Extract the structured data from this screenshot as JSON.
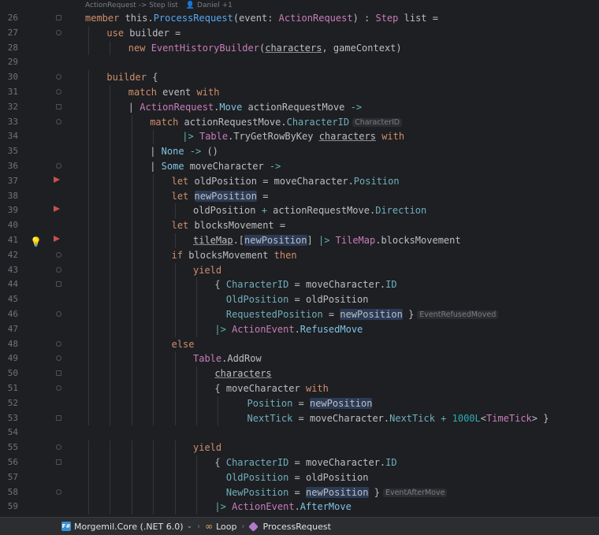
{
  "hint": {
    "signature": "ActionRequest -> Step list",
    "author": "Daniel +1"
  },
  "lines": [
    {
      "n": "26",
      "indent": 0,
      "tokens": [
        [
          "kw",
          "member "
        ],
        [
          "plain",
          "this."
        ],
        [
          "fn",
          "ProcessRequest"
        ],
        [
          "plain",
          "(event: "
        ],
        [
          "ty",
          "ActionRequest"
        ],
        [
          "plain",
          ") : "
        ],
        [
          "ty",
          "Step"
        ],
        [
          "plain",
          " list ="
        ]
      ]
    },
    {
      "n": "27",
      "indent": 1,
      "tokens": [
        [
          "kw",
          "use "
        ],
        [
          "plain",
          "builder ="
        ]
      ]
    },
    {
      "n": "28",
      "indent": 2,
      "tokens": [
        [
          "kw",
          "new "
        ],
        [
          "ty",
          "EventHistoryBuilder"
        ],
        [
          "plain",
          "("
        ],
        [
          "und",
          "characters"
        ],
        [
          "plain",
          ", gameContext)"
        ]
      ]
    },
    {
      "n": "29",
      "indent": 0,
      "tokens": []
    },
    {
      "n": "30",
      "indent": 1,
      "tokens": [
        [
          "kw",
          "builder "
        ],
        [
          "plain",
          "{"
        ]
      ]
    },
    {
      "n": "31",
      "indent": 2,
      "tokens": [
        [
          "kw",
          "match "
        ],
        [
          "plain",
          "event "
        ],
        [
          "kw",
          "with"
        ]
      ]
    },
    {
      "n": "32",
      "indent": 2,
      "tokens": [
        [
          "plain",
          "| "
        ],
        [
          "ty",
          "ActionRequest"
        ],
        [
          "plain",
          "."
        ],
        [
          "kw2",
          "Move"
        ],
        [
          "plain",
          " actionRequestMove "
        ],
        [
          "op",
          "->"
        ]
      ]
    },
    {
      "n": "33",
      "indent": 3,
      "tokens": [
        [
          "kw",
          "match "
        ],
        [
          "plain",
          "actionRequestMove."
        ],
        [
          "fld",
          "CharacterID"
        ],
        [
          "inlay",
          "CharacterID"
        ]
      ]
    },
    {
      "n": "34",
      "indent": 4.5,
      "tokens": [
        [
          "op",
          "|> "
        ],
        [
          "ty",
          "Table"
        ],
        [
          "plain",
          ".TryGetRowByKey "
        ],
        [
          "und",
          "characters"
        ],
        [
          "plain",
          " "
        ],
        [
          "kw",
          "with"
        ]
      ]
    },
    {
      "n": "35",
      "indent": 3,
      "tokens": [
        [
          "plain",
          "| "
        ],
        [
          "kw2",
          "None"
        ],
        [
          "plain",
          " "
        ],
        [
          "op",
          "->"
        ],
        [
          "plain",
          " ()"
        ]
      ]
    },
    {
      "n": "36",
      "indent": 3,
      "tokens": [
        [
          "plain",
          "| "
        ],
        [
          "kw2",
          "Some"
        ],
        [
          "plain",
          " moveCharacter "
        ],
        [
          "op",
          "->"
        ]
      ]
    },
    {
      "n": "37",
      "indent": 4,
      "tokens": [
        [
          "kw",
          "let "
        ],
        [
          "plain",
          "oldPosition = moveCharacter."
        ],
        [
          "fld",
          "Position"
        ]
      ]
    },
    {
      "n": "38",
      "indent": 4,
      "tokens": [
        [
          "kw",
          "let "
        ],
        [
          "hl",
          "newPosition"
        ],
        [
          "plain",
          " ="
        ]
      ]
    },
    {
      "n": "39",
      "indent": 5,
      "tokens": [
        [
          "plain",
          "oldPosition "
        ],
        [
          "op",
          "+"
        ],
        [
          "plain",
          " actionRequestMove."
        ],
        [
          "fld",
          "Direction"
        ]
      ]
    },
    {
      "n": "40",
      "indent": 4,
      "tokens": [
        [
          "kw",
          "let "
        ],
        [
          "plain",
          "blocksMovement ="
        ]
      ]
    },
    {
      "n": "41",
      "indent": 5,
      "tokens": [
        [
          "und",
          "tileMap"
        ],
        [
          "plain",
          ".["
        ],
        [
          "hl",
          "newPosition"
        ],
        [
          "plain",
          "] "
        ],
        [
          "op",
          "|> "
        ],
        [
          "ty",
          "TileMap"
        ],
        [
          "plain",
          ".blocksMovement"
        ]
      ]
    },
    {
      "n": "42",
      "indent": 4,
      "tokens": [
        [
          "kw",
          "if "
        ],
        [
          "plain",
          "blocksMovement "
        ],
        [
          "kw",
          "then"
        ]
      ]
    },
    {
      "n": "43",
      "indent": 5,
      "tokens": [
        [
          "kw",
          "yield"
        ]
      ]
    },
    {
      "n": "44",
      "indent": 6,
      "tokens": [
        [
          "plain",
          "{ "
        ],
        [
          "fld",
          "CharacterID"
        ],
        [
          "plain",
          " = moveCharacter."
        ],
        [
          "fld",
          "ID"
        ]
      ]
    },
    {
      "n": "45",
      "indent": 6,
      "tokens": [
        [
          "plain",
          "  "
        ],
        [
          "fld",
          "OldPosition"
        ],
        [
          "plain",
          " = oldPosition"
        ]
      ]
    },
    {
      "n": "46",
      "indent": 6,
      "tokens": [
        [
          "plain",
          "  "
        ],
        [
          "fld",
          "RequestedPosition"
        ],
        [
          "plain",
          " = "
        ],
        [
          "hl",
          "newPosition"
        ],
        [
          "plain",
          " }"
        ],
        [
          "inlay",
          "EventRefusedMoved"
        ]
      ]
    },
    {
      "n": "47",
      "indent": 6,
      "tokens": [
        [
          "op",
          "|> "
        ],
        [
          "ty",
          "ActionEvent"
        ],
        [
          "plain",
          "."
        ],
        [
          "kw2",
          "RefusedMove"
        ]
      ]
    },
    {
      "n": "48",
      "indent": 4,
      "tokens": [
        [
          "kw",
          "else"
        ]
      ]
    },
    {
      "n": "49",
      "indent": 5,
      "tokens": [
        [
          "ty",
          "Table"
        ],
        [
          "plain",
          ".AddRow"
        ]
      ]
    },
    {
      "n": "50",
      "indent": 6,
      "tokens": [
        [
          "und",
          "characters"
        ]
      ]
    },
    {
      "n": "51",
      "indent": 6,
      "tokens": [
        [
          "plain",
          "{ moveCharacter "
        ],
        [
          "kw",
          "with"
        ]
      ]
    },
    {
      "n": "52",
      "indent": 7.5,
      "tokens": [
        [
          "fld",
          "Position"
        ],
        [
          "plain",
          " = "
        ],
        [
          "hl",
          "newPosition"
        ]
      ]
    },
    {
      "n": "53",
      "indent": 7.5,
      "tokens": [
        [
          "fld",
          "NextTick"
        ],
        [
          "plain",
          " = moveCharacter."
        ],
        [
          "fld",
          "NextTick"
        ],
        [
          "plain",
          " "
        ],
        [
          "op",
          "+"
        ],
        [
          "plain",
          " "
        ],
        [
          "num",
          "1000L"
        ],
        [
          "plain",
          "<"
        ],
        [
          "ty",
          "TimeTick"
        ],
        [
          "plain",
          "> }"
        ]
      ]
    },
    {
      "n": "54",
      "indent": 0,
      "tokens": []
    },
    {
      "n": "55",
      "indent": 5,
      "tokens": [
        [
          "kw",
          "yield"
        ]
      ]
    },
    {
      "n": "56",
      "indent": 6,
      "tokens": [
        [
          "plain",
          "{ "
        ],
        [
          "fld",
          "CharacterID"
        ],
        [
          "plain",
          " = moveCharacter."
        ],
        [
          "fld",
          "ID"
        ]
      ]
    },
    {
      "n": "57",
      "indent": 6,
      "tokens": [
        [
          "plain",
          "  "
        ],
        [
          "fld",
          "OldPosition"
        ],
        [
          "plain",
          " = oldPosition"
        ]
      ]
    },
    {
      "n": "58",
      "indent": 6,
      "tokens": [
        [
          "plain",
          "  "
        ],
        [
          "fld",
          "NewPosition"
        ],
        [
          "plain",
          " = "
        ],
        [
          "hl",
          "newPosition"
        ],
        [
          "plain",
          " }"
        ],
        [
          "inlay",
          "EventAfterMove"
        ]
      ]
    },
    {
      "n": "59",
      "indent": 6,
      "tokens": [
        [
          "op",
          "|> "
        ],
        [
          "ty",
          "ActionEvent"
        ],
        [
          "plain",
          "."
        ],
        [
          "kw2",
          "AfterMove"
        ]
      ]
    }
  ],
  "gutter": {
    "folds": [
      "26",
      "27",
      "30",
      "31",
      "32",
      "33",
      "36",
      "42",
      "43",
      "44",
      "46",
      "48",
      "49",
      "50",
      "51",
      "53",
      "55",
      "56",
      "58"
    ],
    "breakpoints": [
      "37",
      "39",
      "41"
    ],
    "bulb": "41"
  },
  "breadcrumbs": [
    {
      "label": "Morgemil.Core (.NET 6.0)",
      "icon": "fsharp-project-icon",
      "dropdown": true
    },
    {
      "label": "Loop",
      "icon": "loop-icon"
    },
    {
      "label": "ProcessRequest",
      "icon": "method-icon"
    }
  ],
  "colors": {
    "background": "#1e1f22",
    "keyword": "#cf8e6d",
    "type": "#c77dbb",
    "function": "#56a8f5",
    "field": "#6fafbd"
  }
}
